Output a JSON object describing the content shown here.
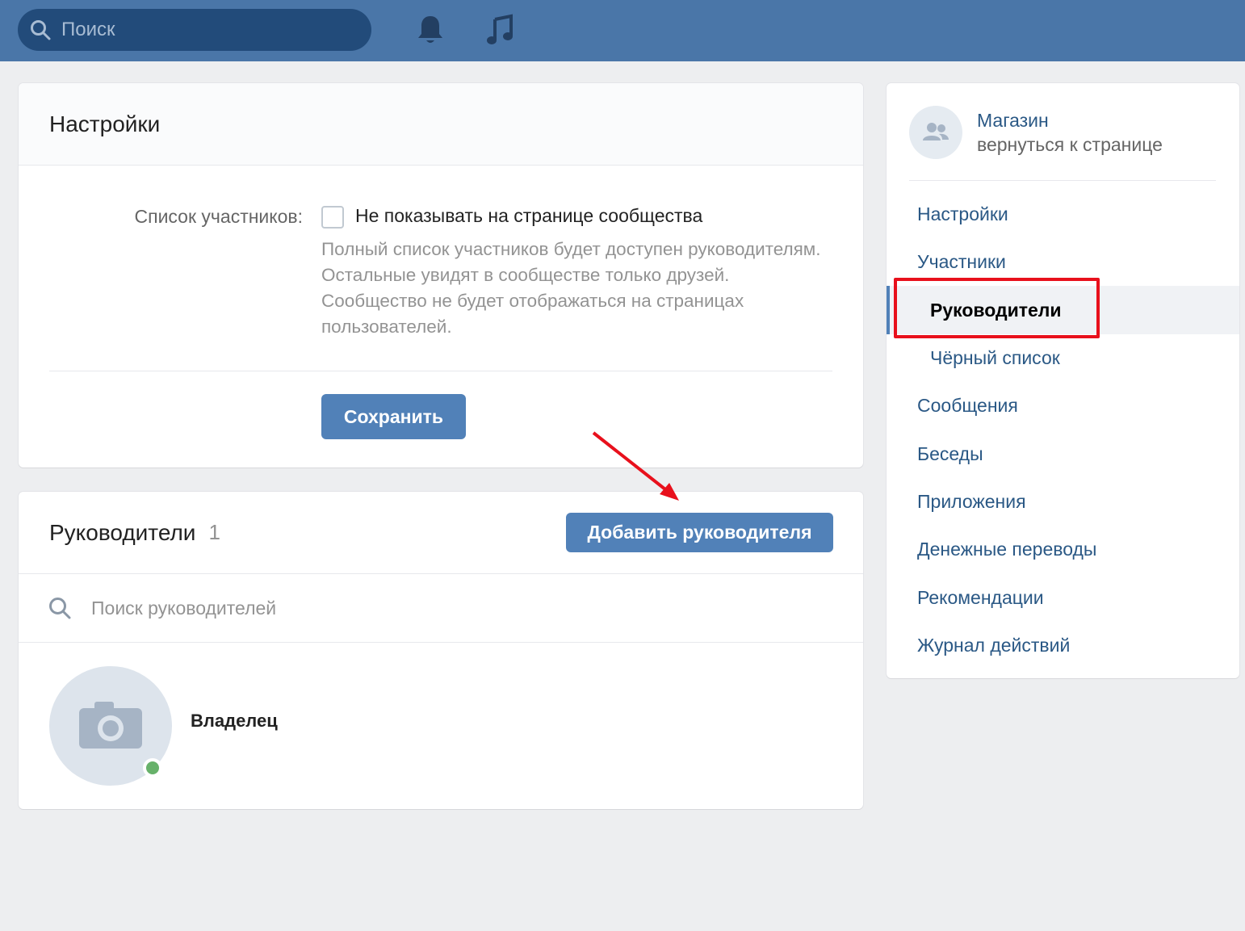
{
  "topbar": {
    "search_placeholder": "Поиск",
    "icons": [
      "search-icon",
      "bell-icon",
      "music-icon"
    ]
  },
  "settings_card": {
    "title": "Настройки",
    "members_label": "Список участников:",
    "checkbox_label": "Не показывать на странице сообщества",
    "checkbox_checked": false,
    "hint": "Полный список участников будет доступен руководителям. Остальные увидят в сообществе только друзей. Сообщество не будет отображаться на страницах пользователей.",
    "save_button": "Сохранить"
  },
  "leaders_card": {
    "title": "Руководители",
    "count": "1",
    "add_button": "Добавить руководителя",
    "search_placeholder": "Поиск руководителей",
    "leaders": [
      {
        "role": "Владелец",
        "online": true
      }
    ]
  },
  "nav": {
    "group_name": "Магазин",
    "back_link": "вернуться к странице",
    "items": [
      {
        "label": "Настройки"
      },
      {
        "label": "Участники"
      },
      {
        "label": "Руководители",
        "active": true
      },
      {
        "label": "Чёрный список"
      },
      {
        "label": "Сообщения"
      },
      {
        "label": "Беседы"
      },
      {
        "label": "Приложения"
      },
      {
        "label": "Денежные переводы"
      },
      {
        "label": "Рекомендации"
      },
      {
        "label": "Журнал действий"
      }
    ]
  },
  "colors": {
    "header": "#4a76a8",
    "button": "#5181b8",
    "link": "#2a5885",
    "highlight": "#e8101c",
    "online": "#67b16a"
  }
}
